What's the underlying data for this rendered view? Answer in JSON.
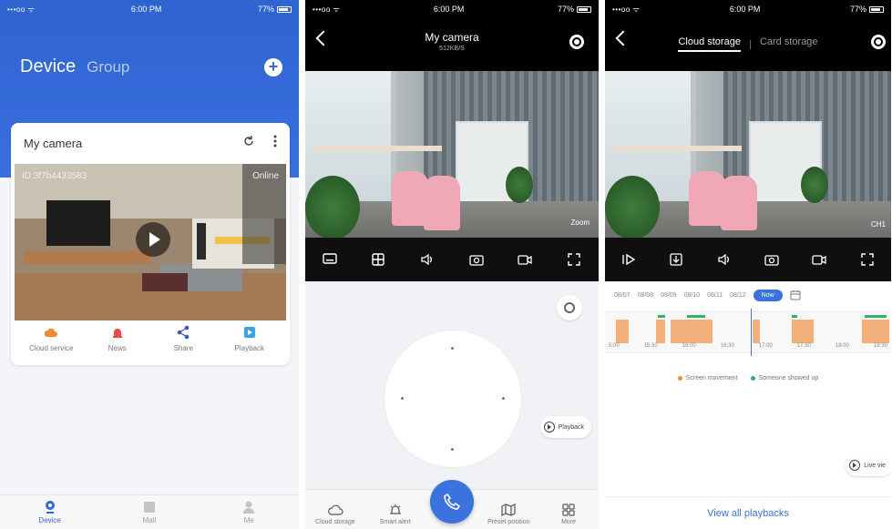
{
  "status": {
    "signal": "•••oo ᯤ",
    "time": "6:00 PM",
    "battery": "77%"
  },
  "home": {
    "title_device": "Device",
    "title_group": "Group",
    "camera_name": "My camera",
    "camera_id": "ID:3f7b4433583",
    "online_label": "Online",
    "actions": [
      {
        "label": "Cloud service",
        "icon": "cloud-icon",
        "color": "#f08a34"
      },
      {
        "label": "News",
        "icon": "news-icon",
        "color": "#e84a4a"
      },
      {
        "label": "Share",
        "icon": "share-icon",
        "color": "#3c5bb8"
      },
      {
        "label": "Playback",
        "icon": "playback-icon",
        "color": "#3aa0e8"
      }
    ],
    "tabs": [
      {
        "label": "Device",
        "icon": "device-icon"
      },
      {
        "label": "Mall",
        "icon": "mall-icon"
      },
      {
        "label": "Me",
        "icon": "me-icon"
      }
    ]
  },
  "live": {
    "title": "My camera",
    "bitrate": "512KB/S",
    "zoom_label": "Zoom",
    "playback_label": "Playback",
    "bottom": [
      {
        "label": "Cloud storage",
        "icon": "cloud-icon"
      },
      {
        "label": "Smart alert",
        "icon": "alert-icon"
      },
      {
        "label": "Preset position",
        "icon": "map-icon"
      },
      {
        "label": "More",
        "icon": "grid-icon"
      }
    ]
  },
  "storage": {
    "tab_cloud": "Cloud storage",
    "tab_card": "Card storage",
    "channel_label": "CH1",
    "dates": [
      "08/07",
      "08/08",
      "08/09",
      "08/10",
      "08/11",
      "08/12"
    ],
    "now_label": "Now",
    "ticks": [
      "5:00",
      "15:30",
      "16:00",
      "16:30",
      "17:00",
      "17:30",
      "18:00",
      "18:30"
    ],
    "legend_movement": "Screen movement",
    "legend_someone": "Someone showed up",
    "movement_color": "#f3b07a",
    "someone_color": "#2fb26a",
    "live_label": "Live vie",
    "view_all": "View all playbacks"
  },
  "accent": "#3a73de"
}
